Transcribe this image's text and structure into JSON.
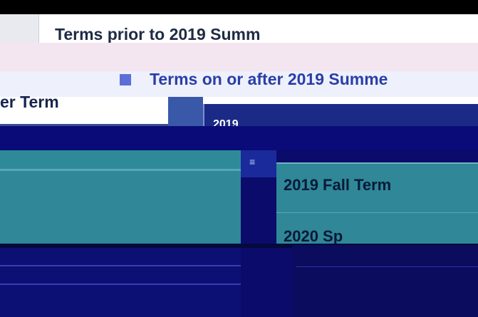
{
  "tabs": {
    "prior": "Terms prior to 2019 Summ",
    "after": "Terms on or after 2019 Summe"
  },
  "left_column": {
    "header": "er Term"
  },
  "right_column": {
    "header": "2019",
    "items": [
      {
        "label": "2019 Fall Term"
      },
      {
        "label": "2020 Sp"
      }
    ]
  },
  "colors": {
    "navy": "#0a0b78",
    "teal": "#2f8797",
    "tab_text": "#2a3ea8"
  },
  "icons": {
    "tab_icon": "term-icon"
  }
}
